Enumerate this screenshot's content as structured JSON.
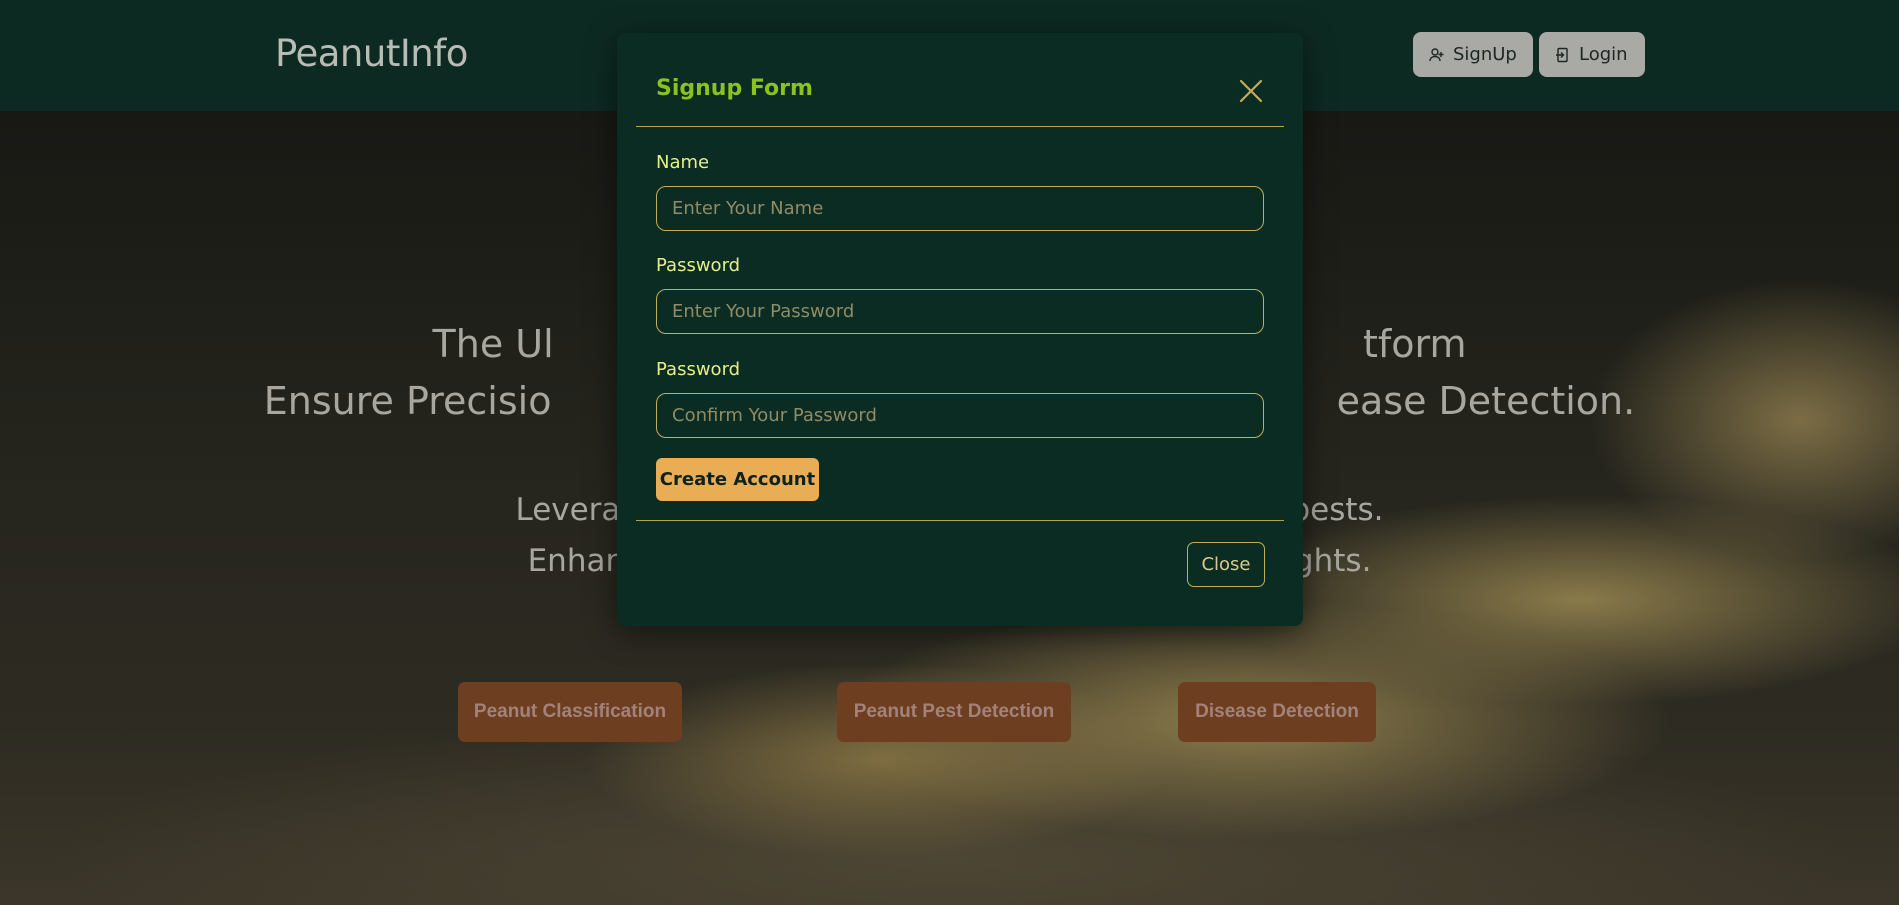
{
  "navbar": {
    "brand": "PeanutInfo",
    "signup_label": "SignUp",
    "login_label": "Login"
  },
  "hero": {
    "title_line_1": "The Ul                                                                   tform",
    "title_line_2": "Ensure Precisio                                                                 ease Detection.",
    "sub_line_1": "Leverag                                                                  pests.",
    "sub_line_2": "Enhan                                                                   ights."
  },
  "features": [
    {
      "label": "Peanut Classification"
    },
    {
      "label": "Peanut Pest Detection"
    },
    {
      "label": "Disease Detection"
    }
  ],
  "modal": {
    "title": "Signup Form",
    "name_label": "Name",
    "name_placeholder": "Enter Your Name",
    "password_label": "Password",
    "password_placeholder": "Enter Your Password",
    "confirm_label": "Password",
    "confirm_placeholder": "Confirm Your Password",
    "create_label": "Create Account",
    "close_label": "Close"
  },
  "colors": {
    "navbar": "#0d2a22",
    "modal": "#0b2c22",
    "title_green": "#8cc21f",
    "label_yellow": "#e6ef8a",
    "create_button": "#e8ad55",
    "feature_button": "#6e3e20"
  },
  "icons": {
    "signup": "user-plus-icon",
    "login": "login-door-icon",
    "close": "close-icon"
  }
}
